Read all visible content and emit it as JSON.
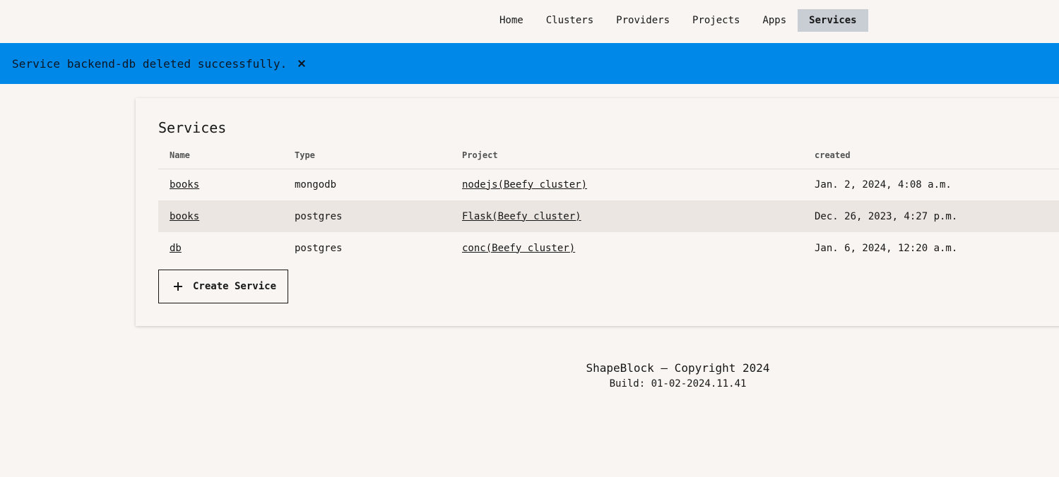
{
  "nav": {
    "items": [
      {
        "label": "Home",
        "active": false
      },
      {
        "label": "Clusters",
        "active": false
      },
      {
        "label": "Providers",
        "active": false
      },
      {
        "label": "Projects",
        "active": false
      },
      {
        "label": "Apps",
        "active": false
      },
      {
        "label": "Services",
        "active": true
      }
    ]
  },
  "banner": {
    "message": "Service backend-db deleted successfully.",
    "color": "#0088e8"
  },
  "services": {
    "title": "Services",
    "columns": [
      "Name",
      "Type",
      "Project",
      "created"
    ],
    "rows": [
      {
        "name": "books",
        "type": "mongodb",
        "project": "nodejs(Beefy cluster)",
        "created": "Jan. 2, 2024, 4:08 a.m."
      },
      {
        "name": "books",
        "type": "postgres",
        "project": "Flask(Beefy cluster)",
        "created": "Dec. 26, 2023, 4:27 p.m."
      },
      {
        "name": "db",
        "type": "postgres",
        "project": "conc(Beefy cluster)",
        "created": "Jan. 6, 2024, 12:20 a.m."
      }
    ],
    "create_label": "Create Service"
  },
  "footer": {
    "copyright": "ShapeBlock — Copyright 2024",
    "build": "Build: 01-02-2024.11.41"
  }
}
